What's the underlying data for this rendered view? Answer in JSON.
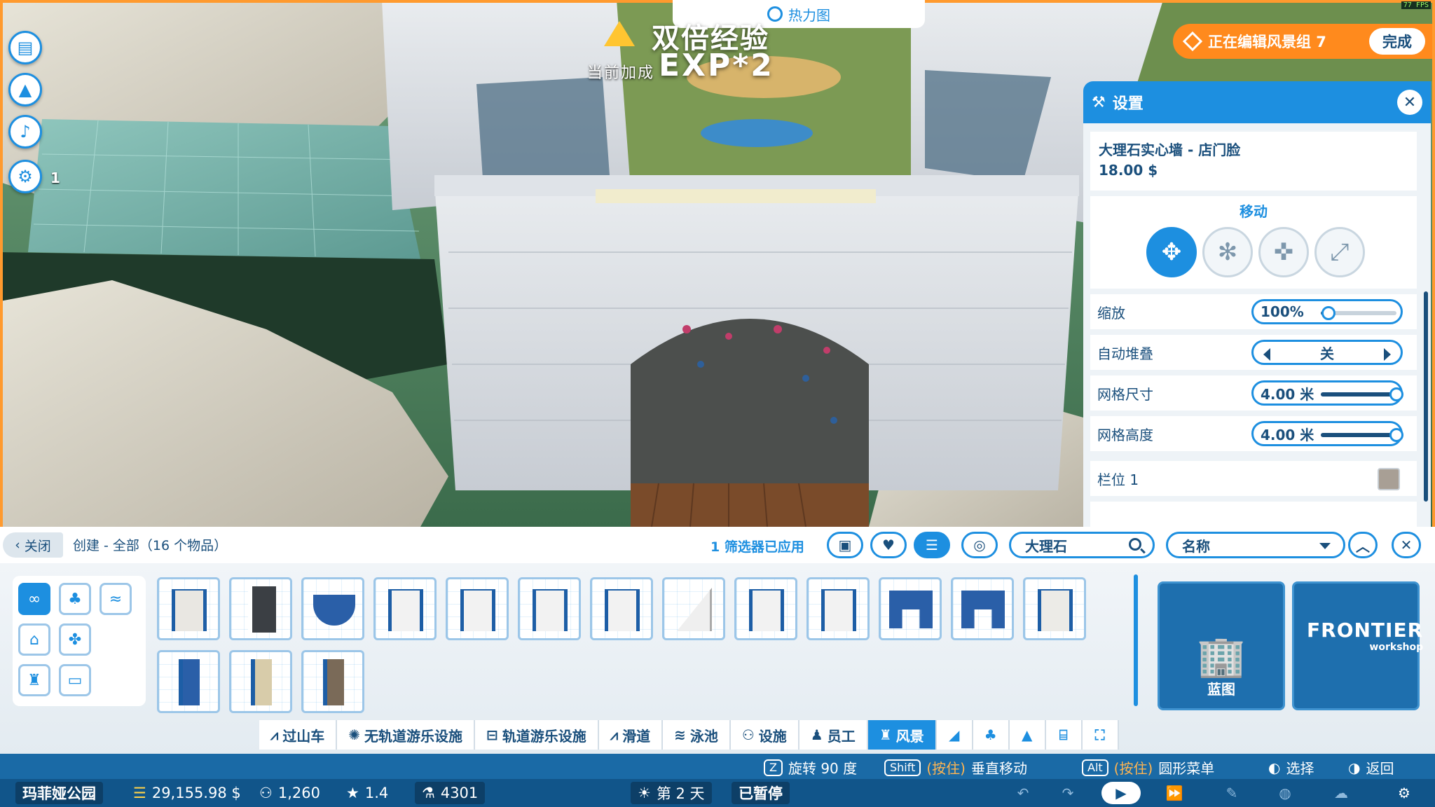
{
  "hud": {
    "heatmap_label": "热力图",
    "exp_title": "双倍经验",
    "exp_subtitle": "当前加成",
    "exp_value": "EXP*2",
    "fps": "77 FPS",
    "alert_count": "1"
  },
  "edit_banner": {
    "text": "正在编辑风景组 7",
    "done_label": "完成"
  },
  "settings": {
    "title": "设置",
    "item_name": "大理石实心墙 - 店门脸",
    "item_price": "18.00 $",
    "move_title": "移动",
    "rows": {
      "scale": {
        "label": "缩放",
        "value": "100%",
        "level": 0.1
      },
      "auto_stack": {
        "label": "自动堆叠",
        "value": "关"
      },
      "grid_size": {
        "label": "网格尺寸",
        "value": "4.00 米",
        "level": 1.0
      },
      "grid_height": {
        "label": "网格高度",
        "value": "4.00 米",
        "level": 1.0
      },
      "slot": {
        "label": "栏位 1",
        "color": "#a89f95"
      }
    }
  },
  "browser": {
    "close_label": "关闭",
    "breadcrumb": "创建 - 全部（16 个物品）",
    "filters_applied": "1 筛选器已应用",
    "search_value": "大理石",
    "sort_value": "名称",
    "blueprint_label": "蓝图",
    "workshop_brand": "FRONTIER",
    "workshop_sub": "workshop"
  },
  "tabs": [
    {
      "label": "过山车",
      "icon": "coaster-icon"
    },
    {
      "label": "无轨道游乐设施",
      "icon": "flat-ride-icon"
    },
    {
      "label": "轨道游乐设施",
      "icon": "track-ride-icon"
    },
    {
      "label": "滑道",
      "icon": "flume-icon"
    },
    {
      "label": "泳池",
      "icon": "pool-icon"
    },
    {
      "label": "设施",
      "icon": "facility-icon"
    },
    {
      "label": "员工",
      "icon": "staff-icon"
    },
    {
      "label": "风景",
      "icon": "scenery-icon"
    }
  ],
  "hints": {
    "rotate_key": "Z",
    "rotate_label": "旋转 90 度",
    "shift_key": "Shift",
    "hold_label": "(按住)",
    "vertical_label": "垂直移动",
    "alt_key": "Alt",
    "radial_label": "圆形菜单",
    "select_label": "选择",
    "back_label": "返回"
  },
  "status": {
    "park_name": "玛菲娅公园",
    "money": "29,155.98 $",
    "guests": "1,260",
    "rating": "1.4",
    "research": "4301",
    "day": "第 2 天",
    "paused": "已暂停"
  },
  "colors": {
    "accent": "#1d8fe0",
    "banner": "#ff8a1d",
    "navy": "#1a4f7c"
  }
}
